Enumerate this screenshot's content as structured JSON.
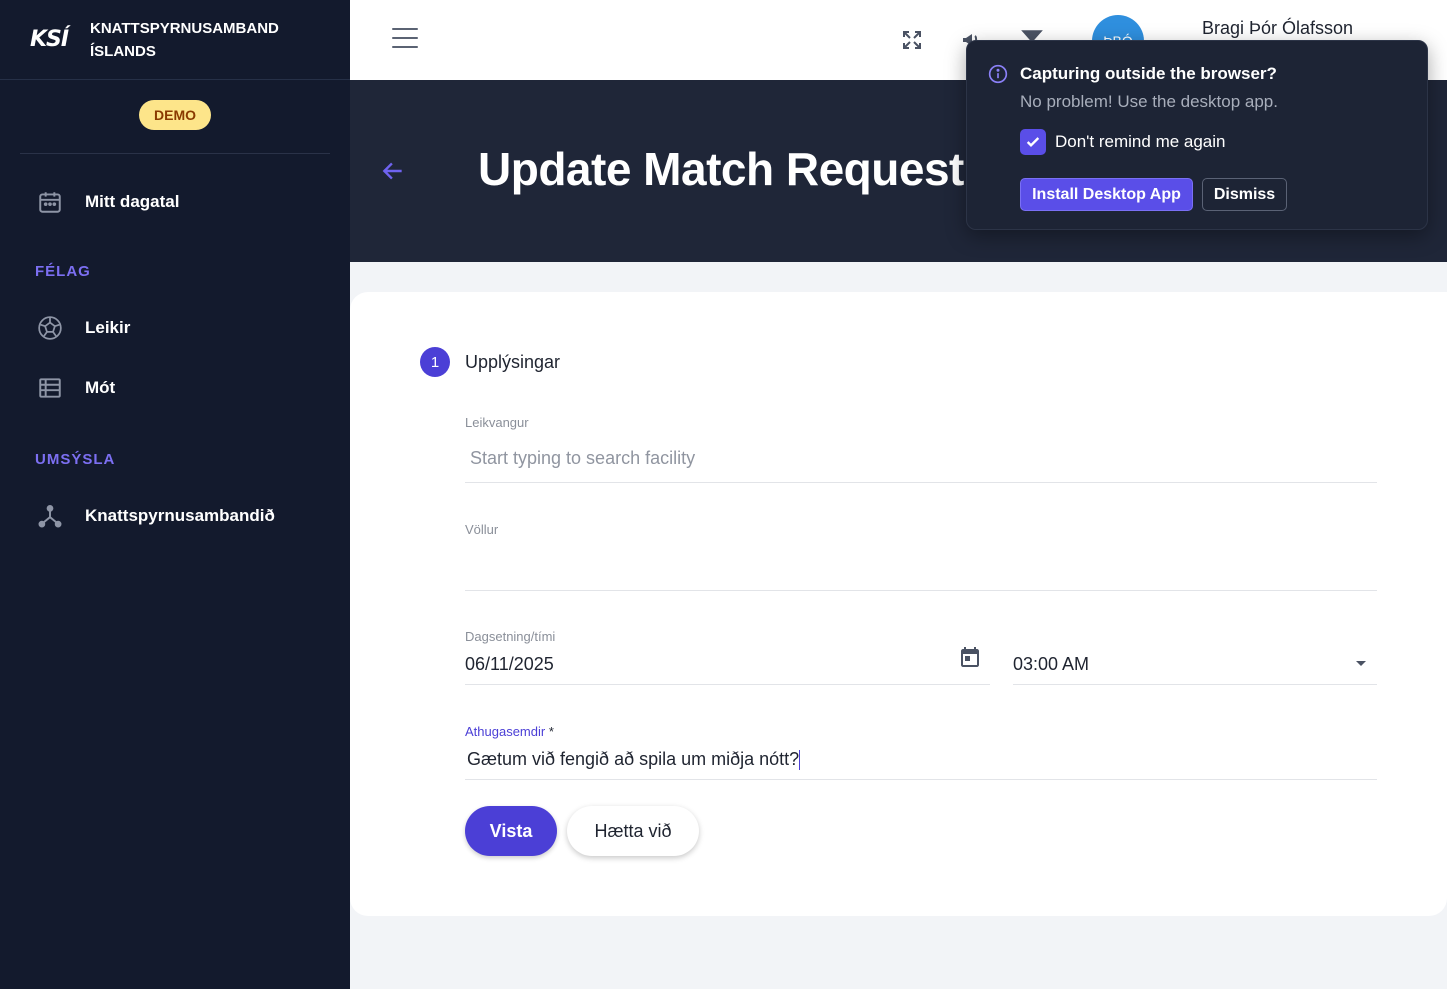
{
  "brand": {
    "logo": "KSÍ",
    "name": "KNATTSPYRNUSAMBAND ÍSLANDS",
    "badge": "DEMO"
  },
  "sidebar": {
    "top_item": {
      "label": "Mitt dagatal",
      "icon": "calendar-icon"
    },
    "sections": [
      {
        "title": "FÉLAG",
        "items": [
          {
            "label": "Leikir",
            "icon": "football-icon"
          },
          {
            "label": "Mót",
            "icon": "list-icon"
          }
        ]
      },
      {
        "title": "UMSÝSLA",
        "items": [
          {
            "label": "Knattspyrnusambandið",
            "icon": "network-icon"
          }
        ]
      }
    ]
  },
  "topbar": {
    "avatar_initials": "ÞBÓ",
    "user_name": "Bragi Þór Ólafsson"
  },
  "header": {
    "title": "Update Match Request"
  },
  "form": {
    "step_number": "1",
    "step_label": "Upplýsingar",
    "facility": {
      "label": "Leikvangur",
      "placeholder": "Start typing to search facility",
      "value": ""
    },
    "field": {
      "label": "Völlur",
      "value": ""
    },
    "datetime": {
      "label": "Dagsetning/tími",
      "date": "06/11/2025",
      "time": "03:00 AM"
    },
    "notes": {
      "label": "Athugasemdir",
      "required": "*",
      "value": "Gætum við fengið að spila um miðja nótt?"
    },
    "save_label": "Vista",
    "cancel_label": "Hætta við"
  },
  "popup": {
    "title": "Capturing outside the browser?",
    "subtitle": "No problem! Use the desktop app.",
    "checkbox_label": "Don't remind me again",
    "checkbox_checked": true,
    "install_label": "Install Desktop App",
    "dismiss_label": "Dismiss"
  },
  "colors": {
    "sidebar": "#131a2d",
    "accent": "#4b3fd6",
    "header": "#1f2638",
    "demo_badge": "#fde58a"
  }
}
